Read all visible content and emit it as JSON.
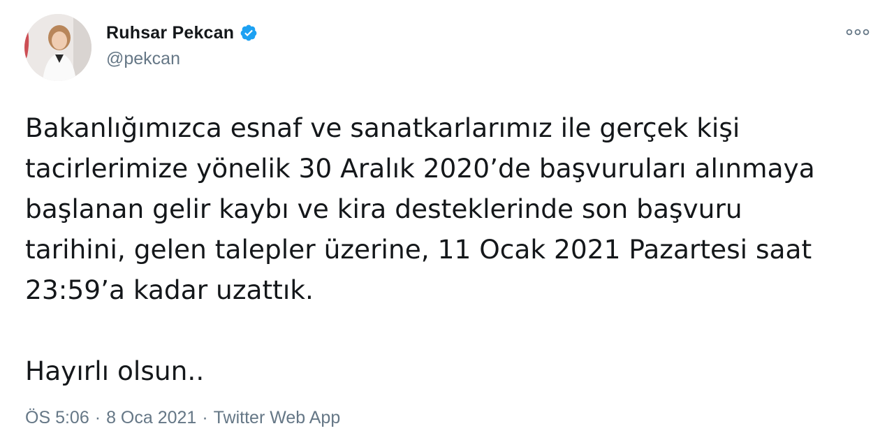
{
  "author": {
    "display_name": "Ruhsar Pekcan",
    "handle": "@pekcan",
    "verified": true
  },
  "tweet": {
    "lines": [
      "Bakanlığımızca esnaf ve sanatkarlarımız ile gerçek kişi",
      "tacirlerimize yönelik 30 Aralık 2020’de başvuruları alınmaya",
      "başlanan gelir kaybı ve kira desteklerinde son başvuru",
      "tarihini, gelen talepler üzerine, 11 Ocak 2021 Pazartesi saat",
      "23:59’a kadar uzattık."
    ],
    "closing": "Hayırlı olsun.."
  },
  "meta": {
    "time": "ÖS 5:06",
    "separator": "·",
    "date": "8 Oca 2021",
    "source": "Twitter Web App"
  },
  "icons": {
    "verified": "verified-badge-icon",
    "more": "more-options-icon"
  },
  "colors": {
    "verified": "#1da1f2",
    "secondary_text": "#657786",
    "primary_text": "#14171a"
  }
}
